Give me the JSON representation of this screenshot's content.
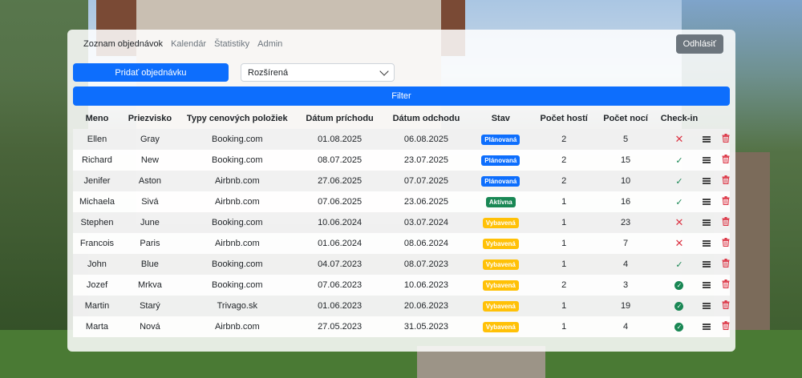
{
  "nav": {
    "items": [
      "Zoznam objednávok",
      "Kalendár",
      "Štatistiky",
      "Admin"
    ],
    "logout_label": "Odhlásiť"
  },
  "controls": {
    "add_label": "Pridať objednávku",
    "view_value": "Rozšírená",
    "filter_label": "Filter"
  },
  "table": {
    "headers": [
      "Meno",
      "Priezvisko",
      "Typy cenových položiek",
      "Dátum príchodu",
      "Dátum odchodu",
      "Stav",
      "Počet hostí",
      "Počet nocí",
      "Check-in"
    ],
    "rows": [
      {
        "first": "Ellen",
        "last": "Gray",
        "type": "Booking.com",
        "arrival": "01.08.2025",
        "departure": "06.08.2025",
        "status": "Plánovaná",
        "status_kind": "planned",
        "guests": "2",
        "nights": "5",
        "checkin": "x"
      },
      {
        "first": "Richard",
        "last": "New",
        "type": "Booking.com",
        "arrival": "08.07.2025",
        "departure": "23.07.2025",
        "status": "Plánovaná",
        "status_kind": "planned",
        "guests": "2",
        "nights": "15",
        "checkin": "check"
      },
      {
        "first": "Jenifer",
        "last": "Aston",
        "type": "Airbnb.com",
        "arrival": "27.06.2025",
        "departure": "07.07.2025",
        "status": "Plánovaná",
        "status_kind": "planned",
        "guests": "2",
        "nights": "10",
        "checkin": "check"
      },
      {
        "first": "Michaela",
        "last": "Sivá",
        "type": "Airbnb.com",
        "arrival": "07.06.2025",
        "departure": "23.06.2025",
        "status": "Aktívna",
        "status_kind": "active",
        "guests": "1",
        "nights": "16",
        "checkin": "check"
      },
      {
        "first": "Stephen",
        "last": "June",
        "type": "Booking.com",
        "arrival": "10.06.2024",
        "departure": "03.07.2024",
        "status": "Vybavená",
        "status_kind": "done",
        "guests": "1",
        "nights": "23",
        "checkin": "x"
      },
      {
        "first": "Francois",
        "last": "Paris",
        "type": "Airbnb.com",
        "arrival": "01.06.2024",
        "departure": "08.06.2024",
        "status": "Vybavená",
        "status_kind": "done",
        "guests": "1",
        "nights": "7",
        "checkin": "x"
      },
      {
        "first": "John",
        "last": "Blue",
        "type": "Booking.com",
        "arrival": "04.07.2023",
        "departure": "08.07.2023",
        "status": "Vybavená",
        "status_kind": "done",
        "guests": "1",
        "nights": "4",
        "checkin": "check"
      },
      {
        "first": "Jozef",
        "last": "Mrkva",
        "type": "Booking.com",
        "arrival": "07.06.2023",
        "departure": "10.06.2023",
        "status": "Vybavená",
        "status_kind": "done",
        "guests": "2",
        "nights": "3",
        "checkin": "circle"
      },
      {
        "first": "Martin",
        "last": "Starý",
        "type": "Trivago.sk",
        "arrival": "01.06.2023",
        "departure": "20.06.2023",
        "status": "Vybavená",
        "status_kind": "done",
        "guests": "1",
        "nights": "19",
        "checkin": "circle"
      },
      {
        "first": "Marta",
        "last": "Nová",
        "type": "Airbnb.com",
        "arrival": "27.05.2023",
        "departure": "31.05.2023",
        "status": "Vybavená",
        "status_kind": "done",
        "guests": "1",
        "nights": "4",
        "checkin": "circle"
      }
    ]
  },
  "colors": {
    "primary": "#0d6efd",
    "planned": "#0d6efd",
    "active": "#198754",
    "done": "#ffc107",
    "danger": "#dc3545"
  },
  "icons": {
    "checkin_no": "x-icon",
    "checkin_yes": "check-icon",
    "checkin_done": "check-circle-icon",
    "detail": "list-icon",
    "delete": "trash-icon"
  }
}
